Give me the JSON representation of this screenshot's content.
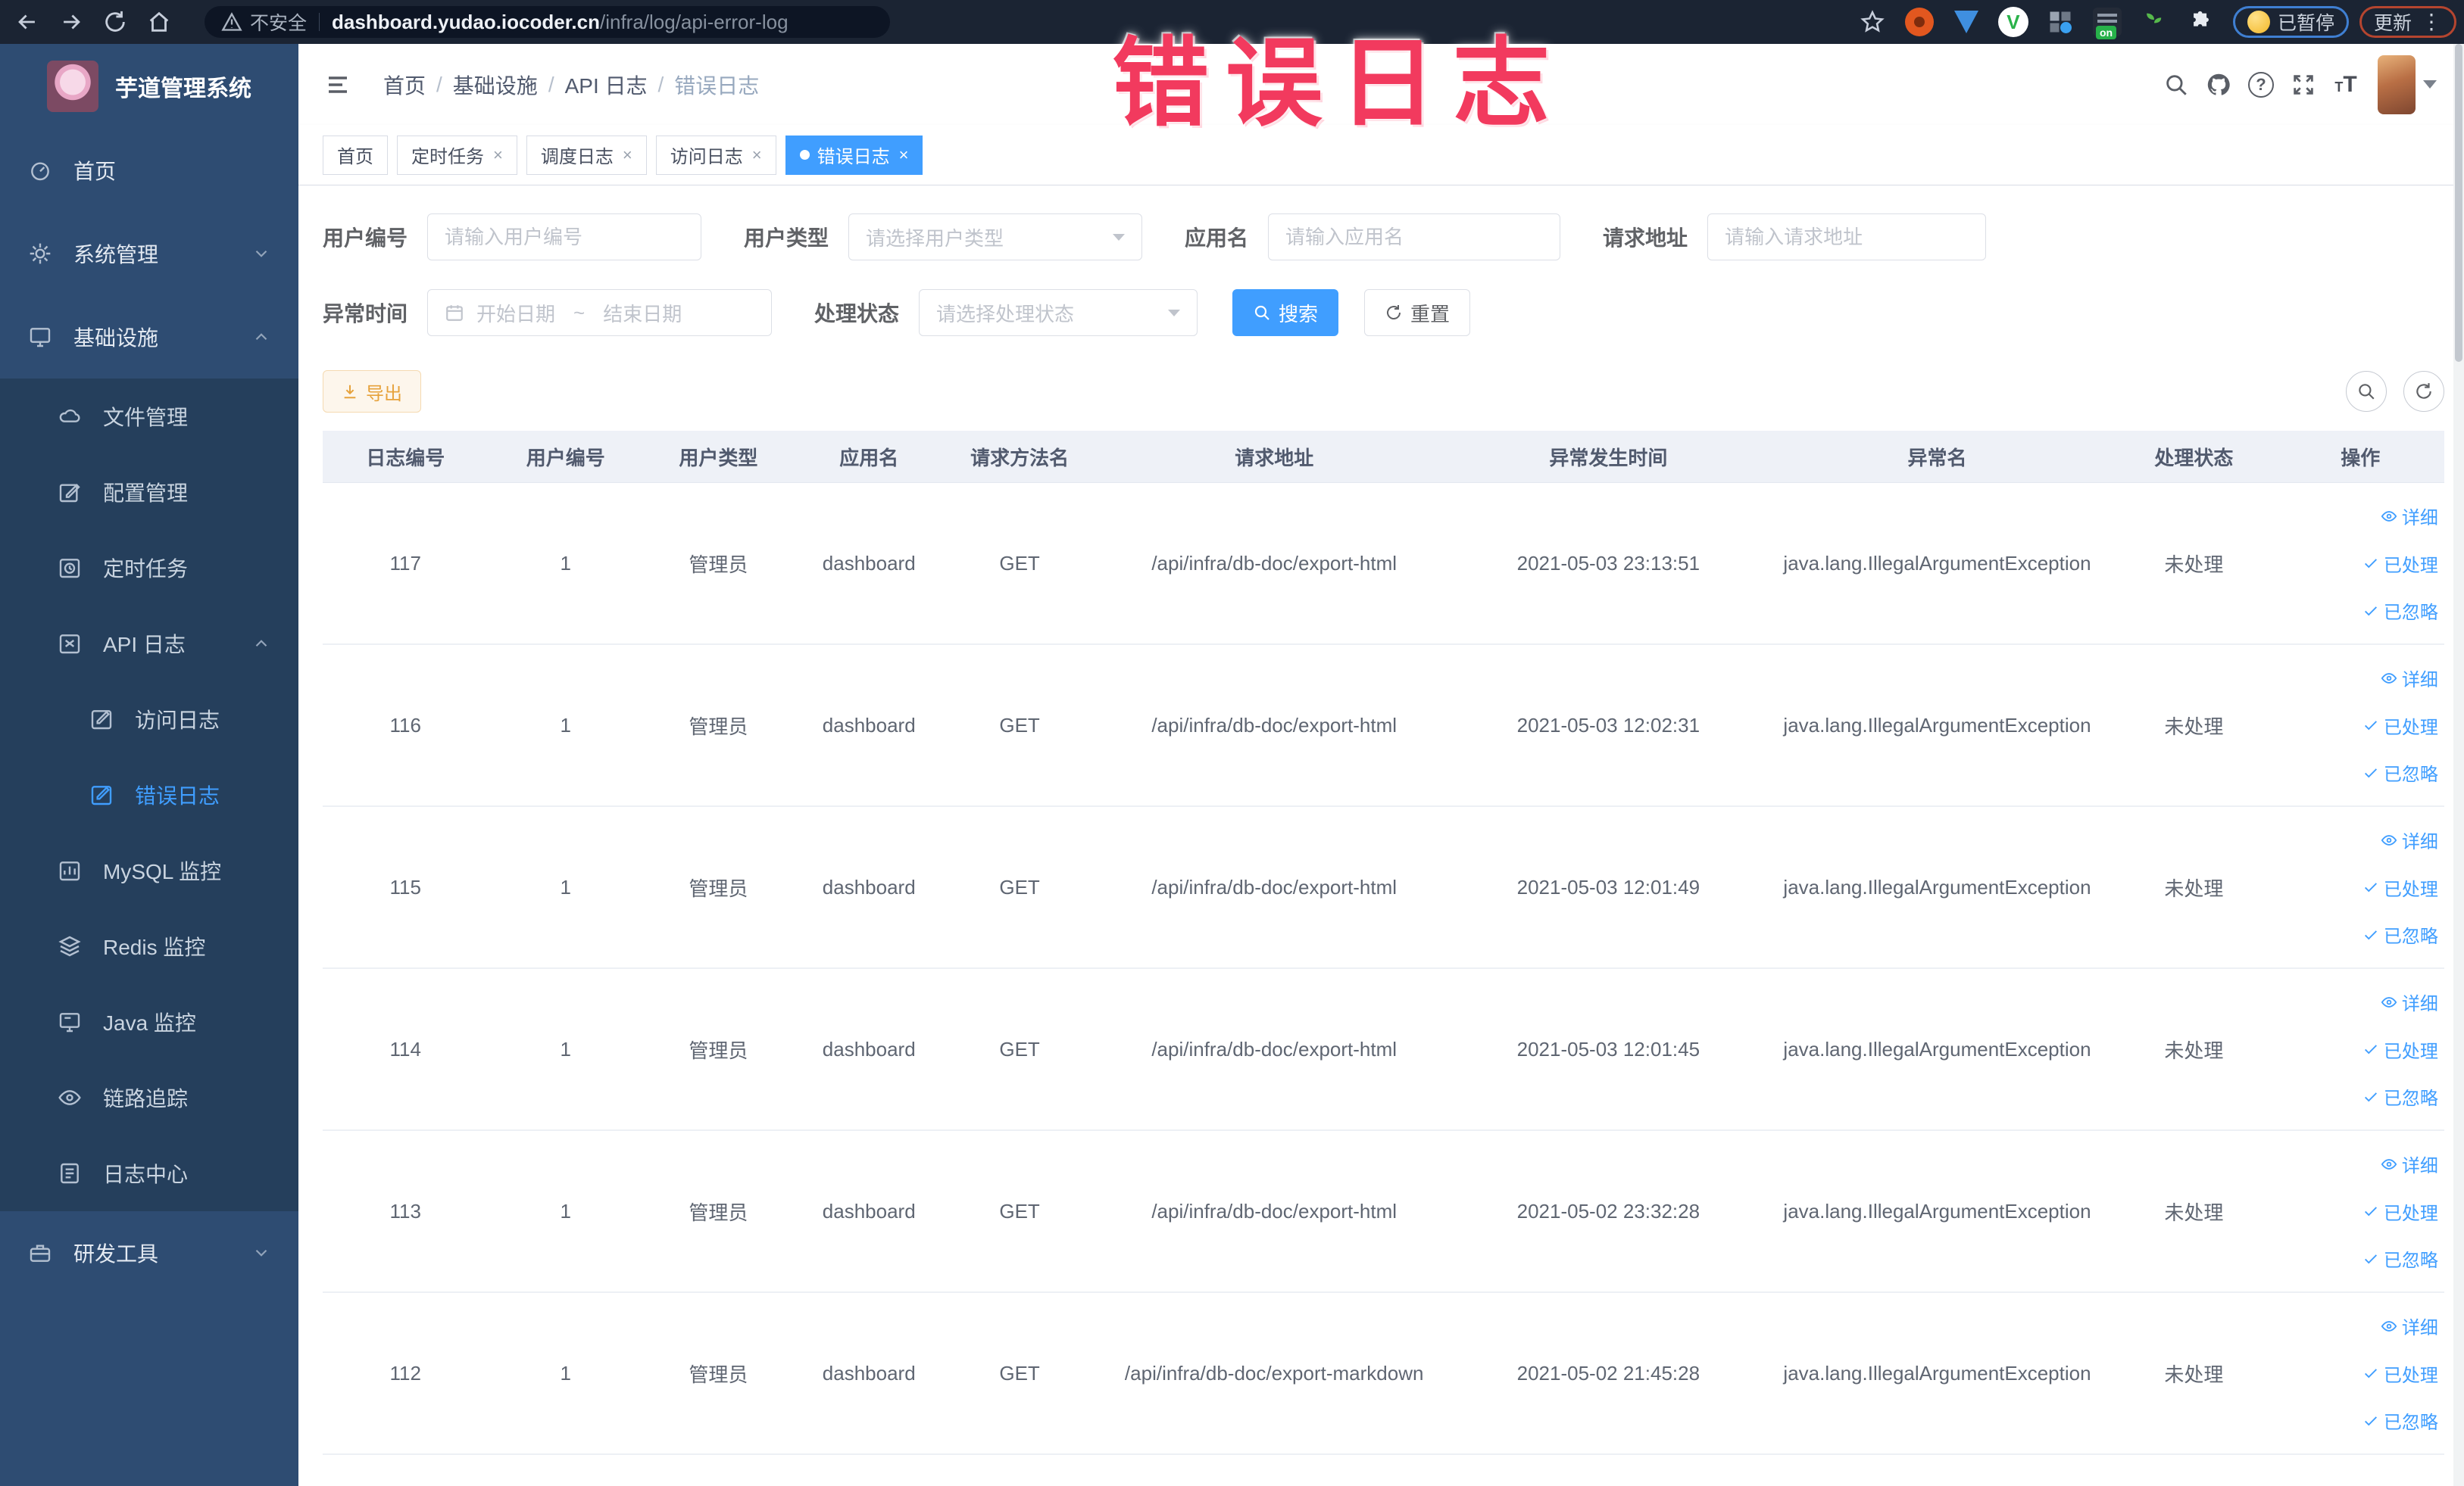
{
  "colors": {
    "accent": "#409EFF",
    "warning": "#e6a23c",
    "watermark": "#f23a5e",
    "sidebar_bg": "#2e4c72",
    "submenu_bg": "#253f5c"
  },
  "watermark": {
    "text": "错误日志"
  },
  "browser": {
    "security_label": "不安全",
    "url_host": "dashboard.yudao.iocoder.cn",
    "url_path": "/infra/log/api-error-log",
    "paused_label": "已暂停",
    "update_label": "更新"
  },
  "sidebar": {
    "title": "芋道管理系统",
    "menu": {
      "home": "首页",
      "system": "系统管理",
      "infra": "基础设施",
      "file": "文件管理",
      "config": "配置管理",
      "job": "定时任务",
      "api_log": "API 日志",
      "access_log": "访问日志",
      "error_log": "错误日志",
      "mysql": "MySQL 监控",
      "redis": "Redis 监控",
      "java": "Java 监控",
      "trace": "链路追踪",
      "log_center": "日志中心",
      "devtool": "研发工具"
    }
  },
  "navbar": {
    "breadcrumb": [
      "首页",
      "基础设施",
      "API 日志",
      "错误日志"
    ],
    "breadcrumb_separator": "/"
  },
  "tabs": [
    {
      "label": "首页"
    },
    {
      "label": "定时任务"
    },
    {
      "label": "调度日志"
    },
    {
      "label": "访问日志"
    },
    {
      "label": "错误日志"
    }
  ],
  "filters": {
    "user_id": {
      "label": "用户编号",
      "placeholder": "请输入用户编号"
    },
    "user_type": {
      "label": "用户类型",
      "placeholder": "请选择用户类型"
    },
    "app_name": {
      "label": "应用名",
      "placeholder": "请输入应用名"
    },
    "request_url": {
      "label": "请求地址",
      "placeholder": "请输入请求地址"
    },
    "exception_time": {
      "label": "异常时间",
      "start_placeholder": "开始日期",
      "separator": "~",
      "end_placeholder": "结束日期"
    },
    "process_status": {
      "label": "处理状态",
      "placeholder": "请选择处理状态"
    },
    "search_label": "搜索",
    "reset_label": "重置"
  },
  "toolbar": {
    "export_label": "导出"
  },
  "table": {
    "columns": [
      "日志编号",
      "用户编号",
      "用户类型",
      "应用名",
      "请求方法名",
      "请求地址",
      "异常发生时间",
      "异常名",
      "处理状态",
      "操作"
    ],
    "actions": [
      "详细",
      "已处理",
      "已忽略"
    ],
    "rows": [
      {
        "log_id": "117",
        "user_id": "1",
        "user_type": "管理员",
        "app_name": "dashboard",
        "method": "GET",
        "url": "/api/infra/db-doc/export-html",
        "time": "2021-05-03 23:13:51",
        "exception": "java.lang.IllegalArgumentException",
        "status": "未处理"
      },
      {
        "log_id": "116",
        "user_id": "1",
        "user_type": "管理员",
        "app_name": "dashboard",
        "method": "GET",
        "url": "/api/infra/db-doc/export-html",
        "time": "2021-05-03 12:02:31",
        "exception": "java.lang.IllegalArgumentException",
        "status": "未处理"
      },
      {
        "log_id": "115",
        "user_id": "1",
        "user_type": "管理员",
        "app_name": "dashboard",
        "method": "GET",
        "url": "/api/infra/db-doc/export-html",
        "time": "2021-05-03 12:01:49",
        "exception": "java.lang.IllegalArgumentException",
        "status": "未处理"
      },
      {
        "log_id": "114",
        "user_id": "1",
        "user_type": "管理员",
        "app_name": "dashboard",
        "method": "GET",
        "url": "/api/infra/db-doc/export-html",
        "time": "2021-05-03 12:01:45",
        "exception": "java.lang.IllegalArgumentException",
        "status": "未处理"
      },
      {
        "log_id": "113",
        "user_id": "1",
        "user_type": "管理员",
        "app_name": "dashboard",
        "method": "GET",
        "url": "/api/infra/db-doc/export-html",
        "time": "2021-05-02 23:32:28",
        "exception": "java.lang.IllegalArgumentException",
        "status": "未处理"
      },
      {
        "log_id": "112",
        "user_id": "1",
        "user_type": "管理员",
        "app_name": "dashboard",
        "method": "GET",
        "url": "/api/infra/db-doc/export-markdown",
        "time": "2021-05-02 21:45:28",
        "exception": "java.lang.IllegalArgumentException",
        "status": "未处理"
      }
    ]
  }
}
